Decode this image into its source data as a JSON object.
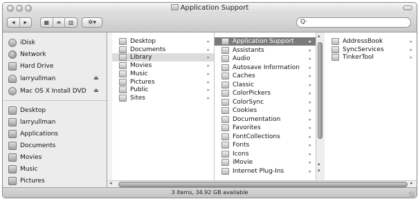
{
  "window": {
    "title": "Application Support"
  },
  "toolbar": {
    "back_label": "◂",
    "forward_label": "▸",
    "view_icon_label": "▦",
    "view_list_label": "≡",
    "view_column_label": "▥",
    "action_label": "✲▾",
    "search": {
      "value": "",
      "glyph": "Q·"
    }
  },
  "sidebar": {
    "devices": [
      {
        "label": "iDisk",
        "icon": "idisk-icon",
        "eject": ""
      },
      {
        "label": "Network",
        "icon": "network-icon",
        "eject": ""
      },
      {
        "label": "Hard Drive",
        "icon": "hard-drive-icon",
        "eject": ""
      },
      {
        "label": "larryullman",
        "icon": "user-icon",
        "eject": "⏏"
      },
      {
        "label": "Mac OS X Install DVD",
        "icon": "dvd-icon",
        "eject": "⏏"
      }
    ],
    "places": [
      {
        "label": "Desktop",
        "icon": "desktop-icon"
      },
      {
        "label": "larryullman",
        "icon": "home-icon"
      },
      {
        "label": "Applications",
        "icon": "applications-icon"
      },
      {
        "label": "Documents",
        "icon": "documents-icon"
      },
      {
        "label": "Movies",
        "icon": "movies-icon"
      },
      {
        "label": "Music",
        "icon": "music-icon"
      },
      {
        "label": "Pictures",
        "icon": "pictures-icon"
      }
    ]
  },
  "columns": {
    "col1": [
      {
        "label": "Desktop",
        "selected": false,
        "highlight": false
      },
      {
        "label": "Documents",
        "selected": false,
        "highlight": false
      },
      {
        "label": "Library",
        "selected": false,
        "highlight": true
      },
      {
        "label": "Movies",
        "selected": false,
        "highlight": false
      },
      {
        "label": "Music",
        "selected": false,
        "highlight": false
      },
      {
        "label": "Pictures",
        "selected": false,
        "highlight": false
      },
      {
        "label": "Public",
        "selected": false,
        "highlight": false
      },
      {
        "label": "Sites",
        "selected": false,
        "highlight": false
      }
    ],
    "col2": [
      {
        "label": "Application Support",
        "selected": true
      },
      {
        "label": "Assistants",
        "selected": false
      },
      {
        "label": "Audio",
        "selected": false
      },
      {
        "label": "Autosave Information",
        "selected": false
      },
      {
        "label": "Caches",
        "selected": false
      },
      {
        "label": "Classic",
        "selected": false
      },
      {
        "label": "ColorPickers",
        "selected": false
      },
      {
        "label": "ColorSync",
        "selected": false
      },
      {
        "label": "Cookies",
        "selected": false
      },
      {
        "label": "Documentation",
        "selected": false
      },
      {
        "label": "Favorites",
        "selected": false
      },
      {
        "label": "FontCollections",
        "selected": false
      },
      {
        "label": "Fonts",
        "selected": false
      },
      {
        "label": "Icons",
        "selected": false
      },
      {
        "label": "iMovie",
        "selected": false
      },
      {
        "label": "Internet Plug-Ins",
        "selected": false
      }
    ],
    "col3": [
      {
        "label": "AddressBook"
      },
      {
        "label": "SyncServices"
      },
      {
        "label": "TinkerTool"
      }
    ],
    "arrow_glyph": "▸"
  },
  "status": {
    "text": "3 items, 34.92 GB available"
  },
  "colors": {
    "selection": "#7a7a7a",
    "window_bg": "#e6e6e6"
  }
}
